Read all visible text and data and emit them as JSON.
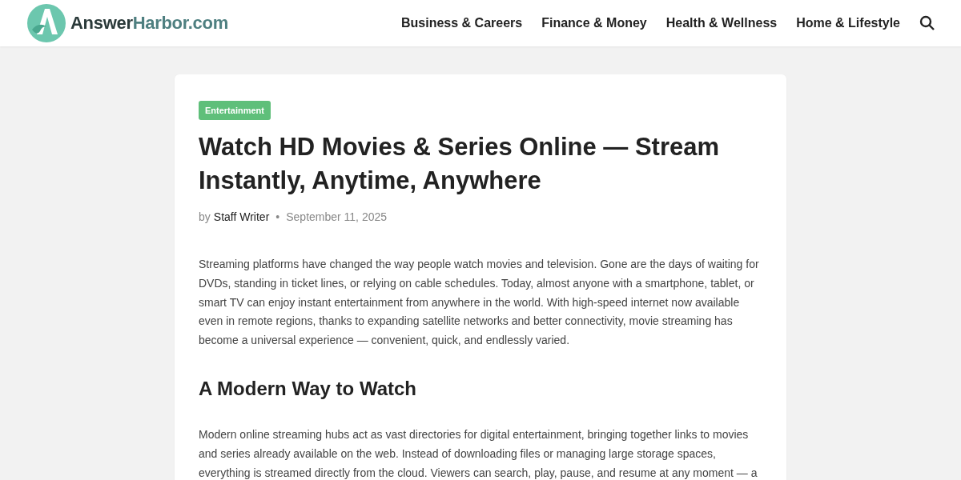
{
  "header": {
    "logo": "**Answer**Harbor.com",
    "nav": [
      "Business & Careers",
      "Finance & Money",
      "Health & Wellness",
      "Home & Lifestyle"
    ]
  },
  "article": {
    "category": "Entertainment",
    "title": "Watch HD Movies & Series Online — Stream Instantly, Anytime, Anywhere",
    "byline": {
      "prefix": "by",
      "author": "Staff Writer",
      "separator": "•",
      "date": "September 11, 2025"
    },
    "content": [
      {
        "kind": "paragraph",
        "text": "Streaming platforms have changed the way people watch movies and television. Gone are the days of waiting for DVDs, standing in ticket lines, or relying on cable schedules. Today, almost anyone with a smartphone, tablet, or smart TV can enjoy instant entertainment from anywhere in the world. With high-speed internet now available even in remote regions, thanks to expanding satellite networks and better connectivity, movie streaming has become a universal experience — convenient, quick, and endlessly varied."
      },
      {
        "kind": "heading",
        "text": "A Modern Way to Watch"
      },
      {
        "kind": "paragraph",
        "text": "Modern online streaming hubs act as vast directories for digital entertainment, bringing together links to movies and series already available on the web. Instead of downloading files or managing large storage spaces, everything is streamed directly from the cloud. Viewers can search, play, pause, and resume at any moment — a"
      }
    ]
  }
}
